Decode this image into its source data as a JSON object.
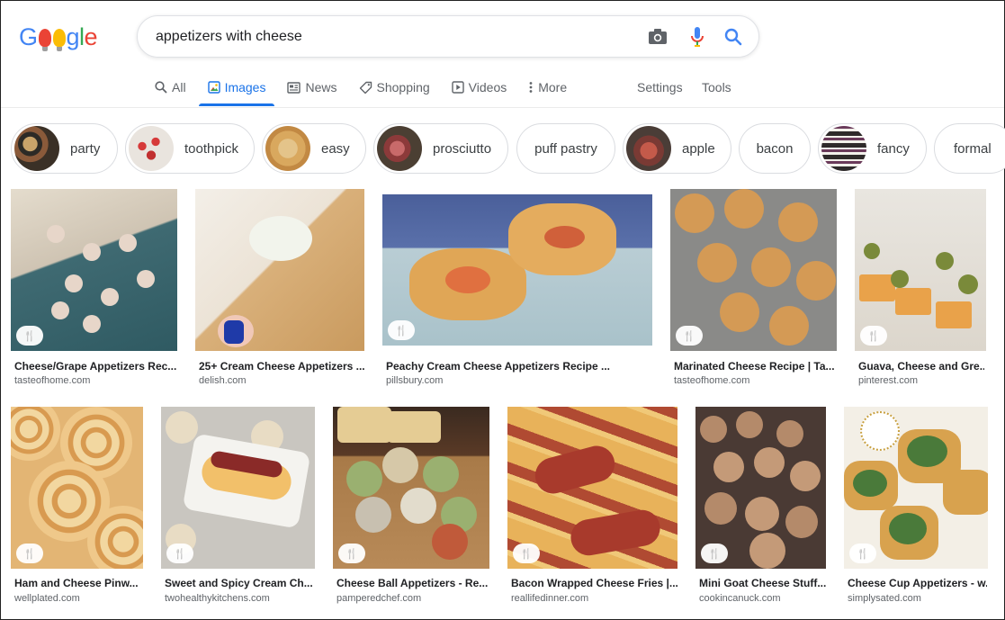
{
  "logo": "Google",
  "search": {
    "query": "appetizers with cheese"
  },
  "tabs": [
    {
      "label": "All",
      "icon": "search-icon"
    },
    {
      "label": "Images",
      "icon": "image-icon",
      "active": true
    },
    {
      "label": "News",
      "icon": "news-icon"
    },
    {
      "label": "Shopping",
      "icon": "tag-icon"
    },
    {
      "label": "Videos",
      "icon": "play-icon"
    },
    {
      "label": "More",
      "icon": "kebab-icon"
    }
  ],
  "settings_label": "Settings",
  "tools_label": "Tools",
  "chips": [
    "party",
    "toothpick",
    "easy",
    "prosciutto",
    "puff pastry",
    "apple",
    "bacon",
    "fancy",
    "formal"
  ],
  "results": [
    {
      "title": "Cheese/Grape Appetizers Rec...",
      "source": "tasteofhome.com"
    },
    {
      "title": "25+ Cream Cheese Appetizers ...",
      "source": "delish.com"
    },
    {
      "title": "Peachy Cream Cheese Appetizers Recipe ...",
      "source": "pillsbury.com"
    },
    {
      "title": "Marinated Cheese Recipe | Ta...",
      "source": "tasteofhome.com"
    },
    {
      "title": "Guava, Cheese and Gre...",
      "source": "pinterest.com"
    },
    {
      "title": "Ham and Cheese Pinw...",
      "source": "wellplated.com"
    },
    {
      "title": "Sweet and Spicy Cream Ch...",
      "source": "twohealthykitchens.com"
    },
    {
      "title": "Cheese Ball Appetizers - Re...",
      "source": "pamperedchef.com"
    },
    {
      "title": "Bacon Wrapped Cheese Fries |...",
      "source": "reallifedinner.com"
    },
    {
      "title": "Mini Goat Cheese Stuff...",
      "source": "cookincanuck.com"
    },
    {
      "title": "Cheese Cup Appetizers - w...",
      "source": "simplysated.com"
    }
  ],
  "colors": {
    "accent": "#1a73e8",
    "text": "#202124",
    "muted": "#5f6368"
  }
}
